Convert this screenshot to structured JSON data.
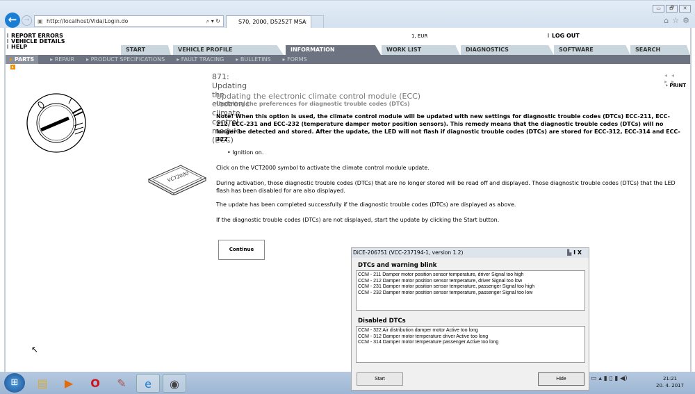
{
  "browser": {
    "url": "http://localhost/Vida/Login.do",
    "tab_title": "S70, 2000, D5252T MSA 15....",
    "tab_close": "×",
    "win_buttons": [
      "▭",
      "🗗",
      "✕"
    ],
    "tools": [
      "⌂",
      "☆",
      "⚙"
    ]
  },
  "header": {
    "links": [
      "REPORT ERRORS",
      "VEHICLE DETAILS",
      "HELP"
    ],
    "locale": "1, EUR",
    "logout": "LOG OUT"
  },
  "tabs": [
    "START",
    "VEHICLE PROFILE",
    "INFORMATION",
    "WORK LIST",
    "DIAGNOSTICS",
    "SOFTWARE",
    "SEARCH"
  ],
  "active_tab": "INFORMATION",
  "subnav": [
    "PARTS",
    "REPAIR",
    "PRODUCT SPECIFICATIONS",
    "FAULT TRACING",
    "BULLETINS",
    "FORMS"
  ],
  "article": {
    "title": "871: Updating the electronic climate control module (ECC)",
    "nav": "◂◂ ▸▸",
    "print": "PRINT",
    "heading": "Updating the electronic climate control module (ECC)",
    "subheading": "Updating the preferences for diagnostic trouble codes (DTCs)",
    "note": "Note! When this option is used, the climate control module will be updated with new settings for diagnostic trouble codes (DTCs) ECC-211, ECC-212, ECC-231 and ECC-232 (temperature damper motor position sensors). This remedy means that the diagnostic trouble codes (DTCs) will no longer be detected and stored. After the update, the LED will not flash if diagnostic trouble codes (DTCs) are stored for ECC-312, ECC-314 and ECC-322.",
    "bullet": "Ignition on.",
    "p1": "Click on the VCT2000 symbol to activate the climate control module update.",
    "p2": "During activation, those diagnostic trouble codes (DTCs) that are no longer stored will be read off and displayed. Those diagnostic trouble codes (DTCs) that the LED flash has been disabled for are also displayed.",
    "p3": "The update has been completed successfully if the diagnostic trouble codes (DTCs) are displayed as above.",
    "p4": "If the diagnostic trouble codes (DTCs) are not displayed, start the update by clicking the Start button.",
    "continue": "Continue"
  },
  "dialog": {
    "title": "DiCE-206751   (VCC-237194-1, version 1.2)",
    "icons": "I  X",
    "section1": "DTCs and warning blink",
    "dtcs": [
      "CCM - 211 Damper motor position sensor temperature, driver Signal too high",
      "CCM - 212 Damper motor position sensor temperature, driver Signal too low",
      "CCM - 231 Damper motor position sensor temperature, passenger Signal too high",
      "CCM - 232 Damper motor position sensor temperature, passenger Signal too low"
    ],
    "section2": "Disabled DTCs",
    "disabled": [
      "CCM - 322 Air distribution damper motor Active too long",
      "CCM - 312 Damper motor temperature driver Active too long",
      "CCM - 314 Damper motor temperature passenger Active too long"
    ],
    "start": "Start",
    "hide": "Hide"
  },
  "taskbar": {
    "time": "21:21",
    "date": "20. 4. 2017"
  },
  "colors": {
    "nav_gray": "#6d7380",
    "tab_light": "#c9d6de",
    "accent": "#f39200",
    "ie_blue": "#1a7fd4"
  }
}
